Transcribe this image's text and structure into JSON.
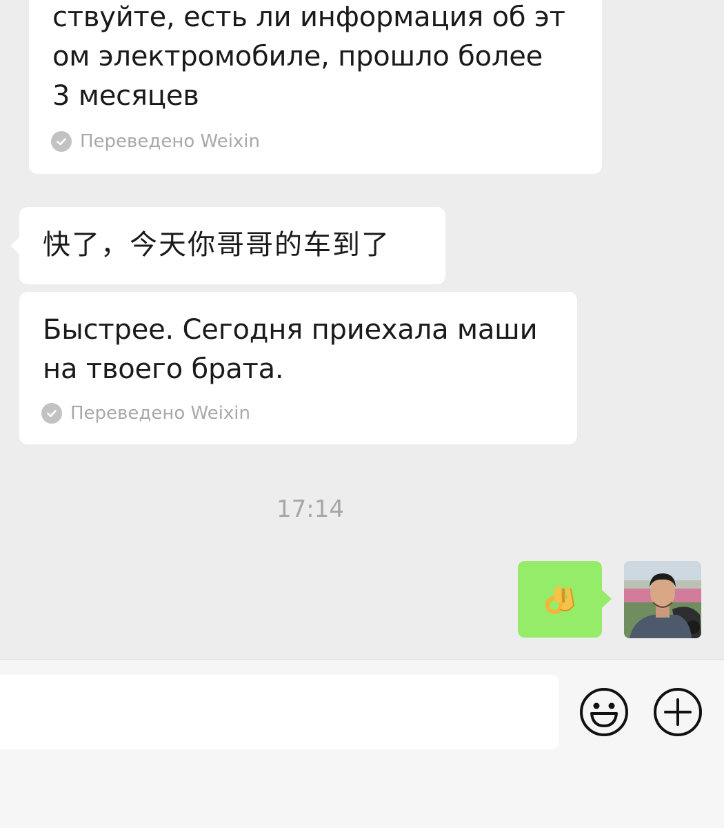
{
  "messages": [
    {
      "translated_text": "ствуйте, есть ли информация об эт\nом электромобиле, прошло более\n3 месяцев",
      "translation_label": "Переведено Weixin"
    },
    {
      "original_text": "快了，今天你哥哥的车到了",
      "translated_text": "Быстрее. Сегодня приехала маши\nна твоего брата.",
      "translation_label": "Переведено Weixin"
    }
  ],
  "timestamp": "17:14",
  "my_message": {
    "emoji": "👌",
    "emoji_name": "ok-hand"
  },
  "input_bar": {
    "placeholder": "",
    "emoji_button_icon": "emoji-smile-icon",
    "more_button_icon": "plus-circle-icon"
  },
  "colors": {
    "chat_background": "#ededed",
    "incoming_bubble": "#ffffff",
    "outgoing_bubble": "#95ec69",
    "input_bar_background": "#f6f6f6"
  }
}
